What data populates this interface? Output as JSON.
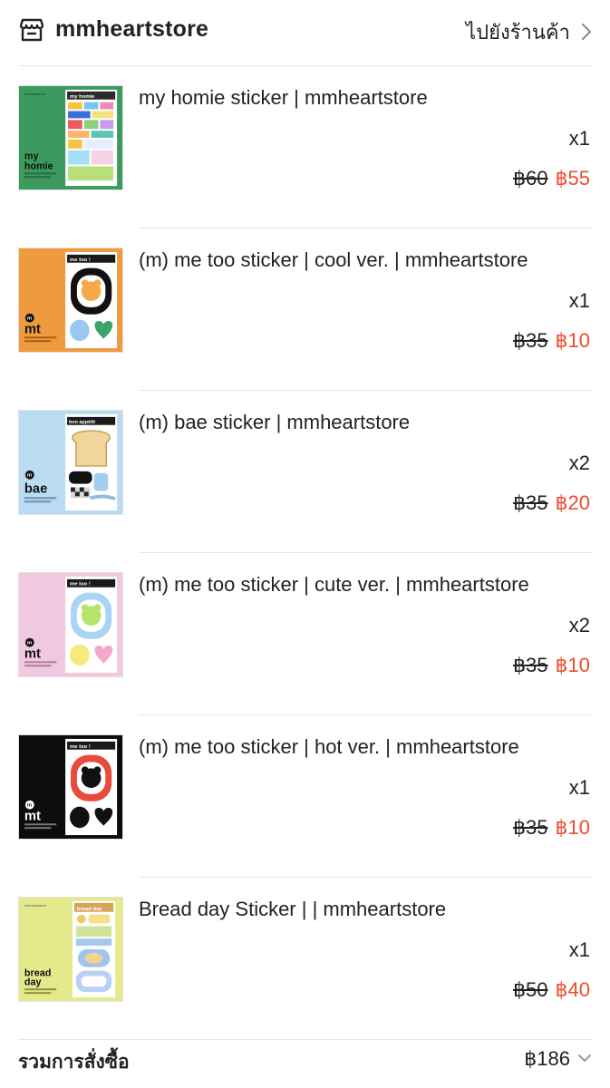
{
  "shop": {
    "name": "mmheartstore",
    "goto_label": "ไปยังร้านค้า"
  },
  "items": [
    {
      "title": "my homie sticker | mmheartstore",
      "qty": "x1",
      "old_price": "฿60",
      "new_price": "฿55",
      "thumb": {
        "bg": "#3c9a5f",
        "icon": "my-homie-sticker-sheet"
      }
    },
    {
      "title": "(m) me too sticker | cool ver. | mmheartstore",
      "qty": "x1",
      "old_price": "฿35",
      "new_price": "฿10",
      "thumb": {
        "bg": "#ef9a3c",
        "icon": "me-too-cool-sticker-sheet"
      }
    },
    {
      "title": "(m) bae sticker | mmheartstore",
      "qty": "x2",
      "old_price": "฿35",
      "new_price": "฿20",
      "thumb": {
        "bg": "#b9dcf2",
        "icon": "bae-sticker-sheet"
      }
    },
    {
      "title": "(m) me too sticker | cute ver. | mmheartstore",
      "qty": "x2",
      "old_price": "฿35",
      "new_price": "฿10",
      "thumb": {
        "bg": "#f0c8e0",
        "icon": "me-too-cute-sticker-sheet"
      }
    },
    {
      "title": "(m) me too sticker | hot ver. | mmheartstore",
      "qty": "x1",
      "old_price": "฿35",
      "new_price": "฿10",
      "thumb": {
        "bg": "#0c0c0c",
        "icon": "me-too-hot-sticker-sheet"
      }
    },
    {
      "title": "Bread day Sticker | | mmheartstore",
      "qty": "x1",
      "old_price": "฿50",
      "new_price": "฿40",
      "thumb": {
        "bg": "#e4ea8c",
        "icon": "bread-day-sticker-sheet"
      }
    }
  ],
  "order": {
    "total_label": "รวมการสั่งซื้อ",
    "total_value": "฿186"
  },
  "colors": {
    "accent_price": "#ee4d2d",
    "text": "#222222",
    "divider": "#e6e6e6"
  }
}
